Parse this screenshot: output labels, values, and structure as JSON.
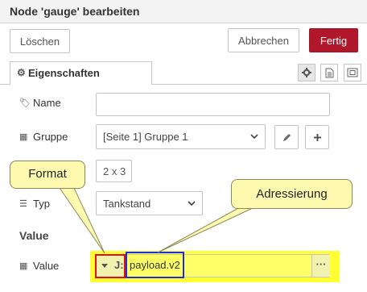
{
  "window": {
    "title": "Node 'gauge' bearbeiten"
  },
  "toolbar": {
    "delete_label": "Löschen",
    "cancel_label": "Abbrechen",
    "done_label": "Fertig"
  },
  "tabs": {
    "properties_label": "Eigenschaften"
  },
  "tab_icons": [
    "gear-icon",
    "document-icon",
    "frame-icon"
  ],
  "form": {
    "name": {
      "label": "Name",
      "value": ""
    },
    "group": {
      "label": "Gruppe",
      "value": "[Seite 1] Gruppe 1"
    },
    "size": {
      "value": "2 x 3"
    },
    "type": {
      "label": "Typ",
      "value": "Tankstand"
    },
    "value_section_label": "Value",
    "value": {
      "label": "Value",
      "type_indicator": "J:",
      "text": "payload.v2",
      "more": "···"
    }
  },
  "annotations": {
    "format": "Format",
    "addressing": "Adressierung"
  },
  "colors": {
    "accent": "#b0172a",
    "highlight": "#ffff33",
    "red_box": "#e01010",
    "blue_box": "#1e2fd8"
  }
}
